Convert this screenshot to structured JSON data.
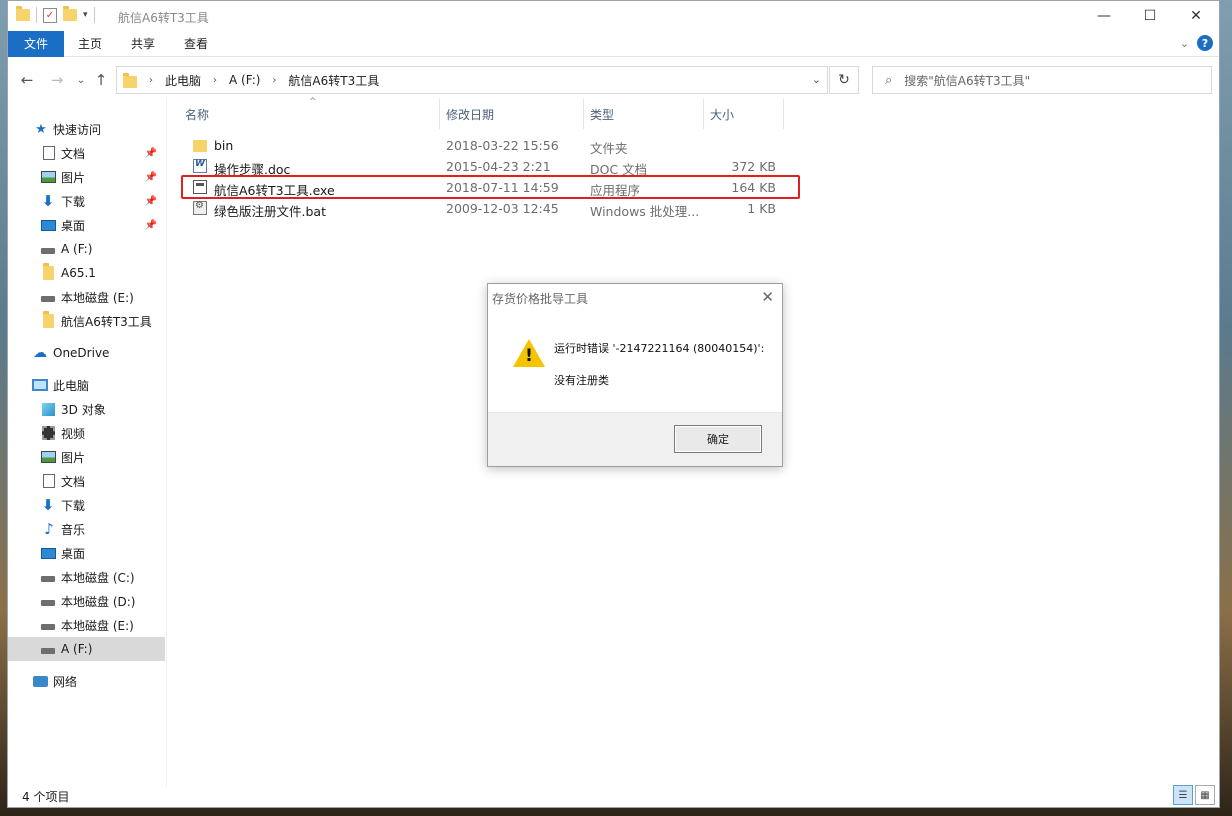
{
  "window": {
    "title": "航信A6转T3工具",
    "controls": {
      "minimize": "—",
      "maximize": "☐",
      "close": "✕"
    }
  },
  "ribbon": {
    "tabs": [
      "文件",
      "主页",
      "共享",
      "查看"
    ],
    "help_label": "?"
  },
  "address": {
    "crumbs": [
      "此电脑",
      "A (F:)",
      "航信A6转T3工具"
    ],
    "search_placeholder": "搜索\"航信A6转T3工具\""
  },
  "sidebar": {
    "items": [
      {
        "label": "快速访问",
        "icon": "star-icon",
        "pinned": false
      },
      {
        "label": "文档",
        "icon": "document-icon",
        "pinned": true
      },
      {
        "label": "图片",
        "icon": "picture-icon",
        "pinned": true
      },
      {
        "label": "下载",
        "icon": "download-icon",
        "pinned": true
      },
      {
        "label": "桌面",
        "icon": "desktop-icon",
        "pinned": true
      },
      {
        "label": "A (F:)",
        "icon": "drive-icon",
        "pinned": false
      },
      {
        "label": "A65.1",
        "icon": "folder-icon",
        "pinned": false
      },
      {
        "label": "本地磁盘 (E:)",
        "icon": "drive-icon",
        "pinned": false
      },
      {
        "label": "航信A6转T3工具",
        "icon": "folder-icon",
        "pinned": false
      },
      {
        "label": "OneDrive",
        "icon": "cloud-icon",
        "pinned": false
      },
      {
        "label": "此电脑",
        "icon": "computer-icon",
        "pinned": false
      },
      {
        "label": "3D 对象",
        "icon": "cube-icon",
        "pinned": false
      },
      {
        "label": "视频",
        "icon": "video-icon",
        "pinned": false
      },
      {
        "label": "图片",
        "icon": "picture-icon",
        "pinned": false
      },
      {
        "label": "文档",
        "icon": "document-icon",
        "pinned": false
      },
      {
        "label": "下载",
        "icon": "download-icon",
        "pinned": false
      },
      {
        "label": "音乐",
        "icon": "music-icon",
        "pinned": false
      },
      {
        "label": "桌面",
        "icon": "desktop-icon",
        "pinned": false
      },
      {
        "label": "本地磁盘 (C:)",
        "icon": "drive-icon",
        "pinned": false
      },
      {
        "label": "本地磁盘 (D:)",
        "icon": "drive-icon",
        "pinned": false
      },
      {
        "label": "本地磁盘 (E:)",
        "icon": "drive-icon",
        "pinned": false
      },
      {
        "label": "A (F:)",
        "icon": "drive-icon",
        "pinned": false,
        "selected": true
      },
      {
        "label": "网络",
        "icon": "network-icon",
        "pinned": false
      }
    ]
  },
  "files": {
    "columns": [
      "名称",
      "修改日期",
      "类型",
      "大小"
    ],
    "rows": [
      {
        "name": "bin",
        "modified": "2018-03-22 15:56",
        "type": "文件夹",
        "size": "",
        "icon": "folder-icon"
      },
      {
        "name": "操作步骤.doc",
        "modified": "2015-04-23 2:21",
        "type": "DOC 文档",
        "size": "372 KB",
        "icon": "word-icon"
      },
      {
        "name": "航信A6转T3工具.exe",
        "modified": "2018-07-11 14:59",
        "type": "应用程序",
        "size": "164 KB",
        "icon": "exe-icon"
      },
      {
        "name": "绿色版注册文件.bat",
        "modified": "2009-12-03 12:45",
        "type": "Windows 批处理...",
        "size": "1 KB",
        "icon": "bat-icon"
      }
    ]
  },
  "status": {
    "item_count": "4 个项目"
  },
  "dialog": {
    "title": "存货价格批导工具",
    "message_line1": "运行时错误 '-2147221164 (80040154)':",
    "message_line2": "没有注册类",
    "ok_label": "确定",
    "close": "✕",
    "warn_mark": "!"
  },
  "colors": {
    "accent": "#1a6fc4",
    "highlight_box": "#e02020",
    "warning": "#f4c400"
  }
}
